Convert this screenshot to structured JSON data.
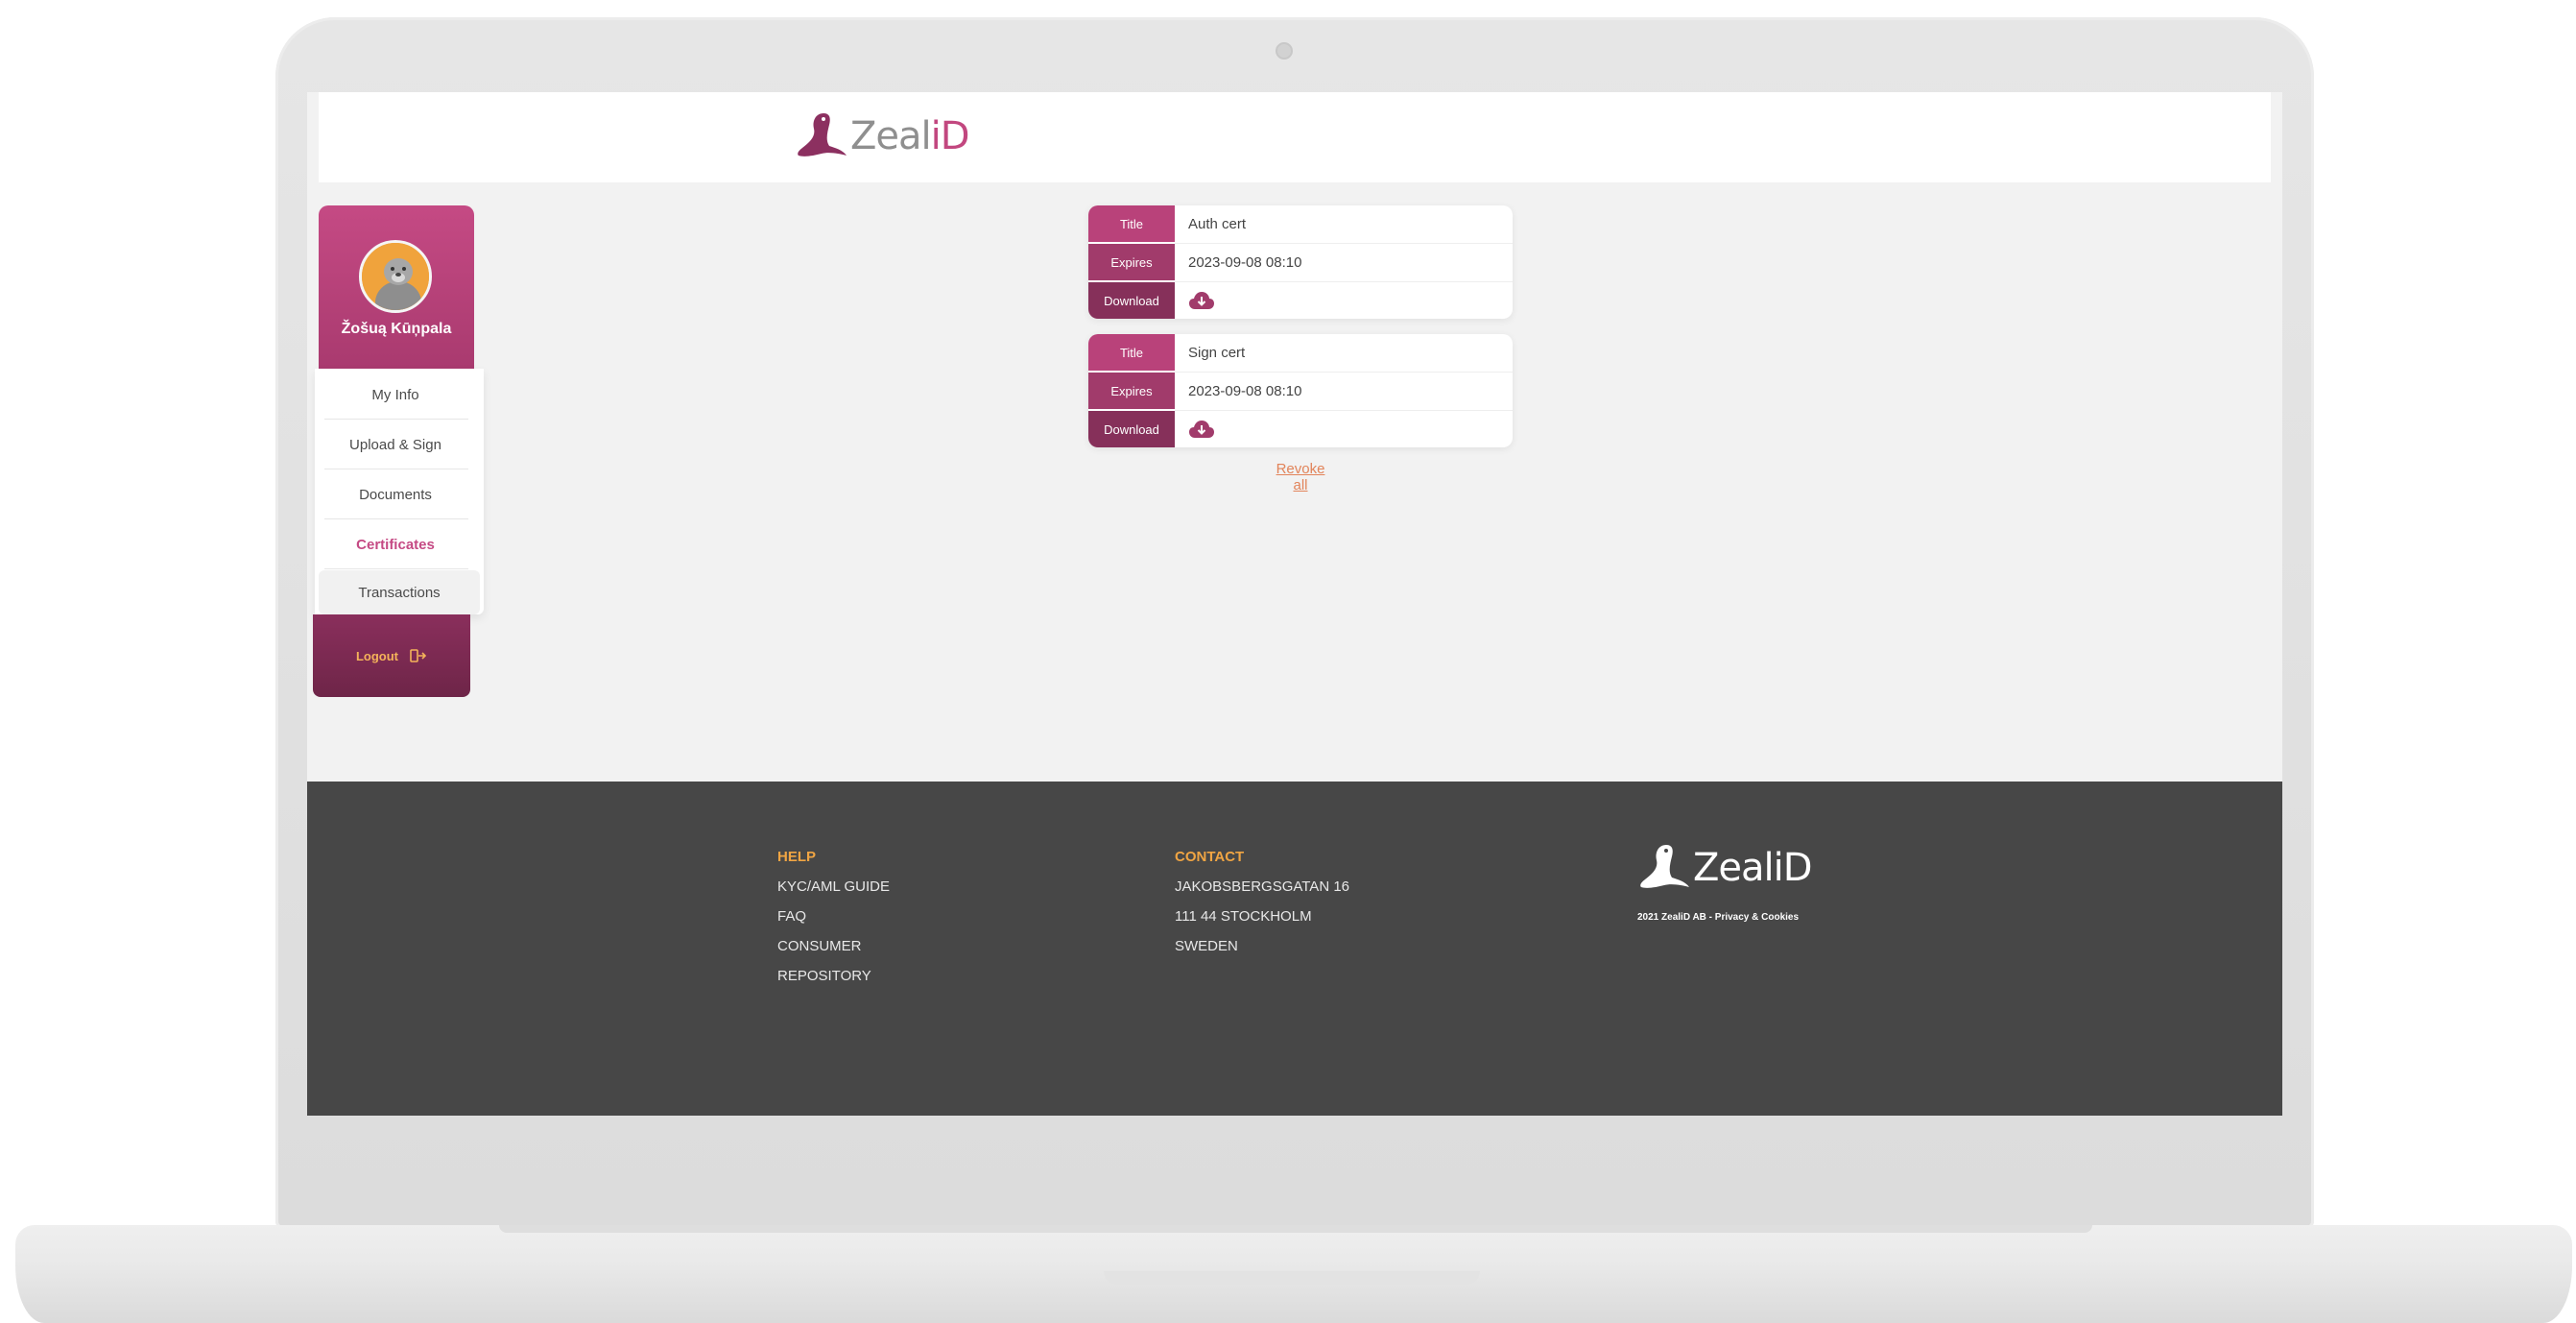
{
  "header": {
    "logo_main": "Zeal",
    "logo_accent": "iD"
  },
  "sidebar": {
    "user_name": "Žošuą Kūņpala",
    "items": [
      {
        "label": "My Info"
      },
      {
        "label": "Upload & Sign"
      },
      {
        "label": "Documents"
      },
      {
        "label": "Certificates",
        "active": true
      },
      {
        "label": "Transactions"
      }
    ],
    "logout_label": "Logout"
  },
  "certificates": [
    {
      "title_label": "Title",
      "title": "Auth cert",
      "expires_label": "Expires",
      "expires": "2023-09-08 08:10",
      "download_label": "Download"
    },
    {
      "title_label": "Title",
      "title": "Sign cert",
      "expires_label": "Expires",
      "expires": "2023-09-08 08:10",
      "download_label": "Download"
    }
  ],
  "revoke_all": "Revoke all",
  "footer": {
    "help_heading": "HELP",
    "help_links": [
      "KYC/AML GUIDE",
      "FAQ",
      "CONSUMER",
      "REPOSITORY"
    ],
    "contact_heading": "CONTACT",
    "contact_lines": [
      "JAKOBSBERGSGATAN 16",
      "111 44 STOCKHOLM",
      "SWEDEN"
    ],
    "logo_text": "ZealiD",
    "copyright": "2021 ZealiD AB - Privacy & Cookies"
  },
  "colors": {
    "brand_pink": "#c54a84",
    "brand_dark": "#86305a",
    "accent_orange": "#f0a543",
    "footer_bg": "#474747"
  },
  "icons": [
    "seal-logo-icon",
    "avatar-seal",
    "logout-icon",
    "cloud-download-icon"
  ]
}
